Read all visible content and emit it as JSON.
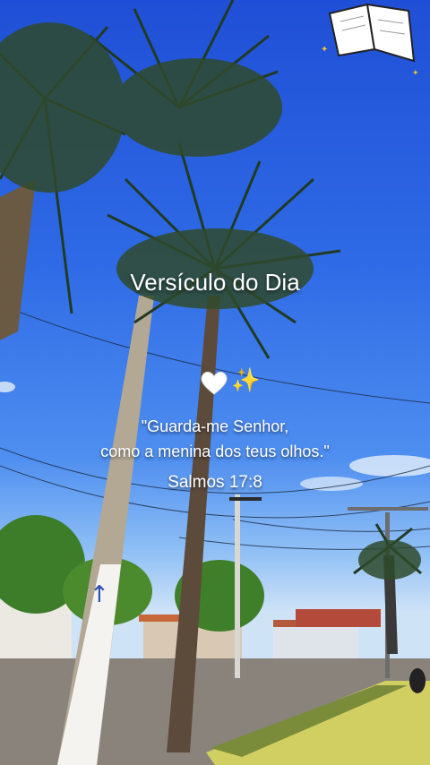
{
  "overlay": {
    "title": "Versículo do Dia",
    "verse_line1": "\"Guarda-me Senhor,",
    "verse_line2": "como a menina dos teus olhos.\"",
    "reference": "Salmos 17:8"
  },
  "icons": {
    "heart": "white-heart-icon",
    "sparkles": "sparkles-icon",
    "book": "open-book-icon"
  },
  "colors": {
    "sky_top": "#1f4fd6",
    "sky_bottom": "#cfe3f7",
    "text": "#ffffff",
    "sparkle": "#f2c230"
  }
}
